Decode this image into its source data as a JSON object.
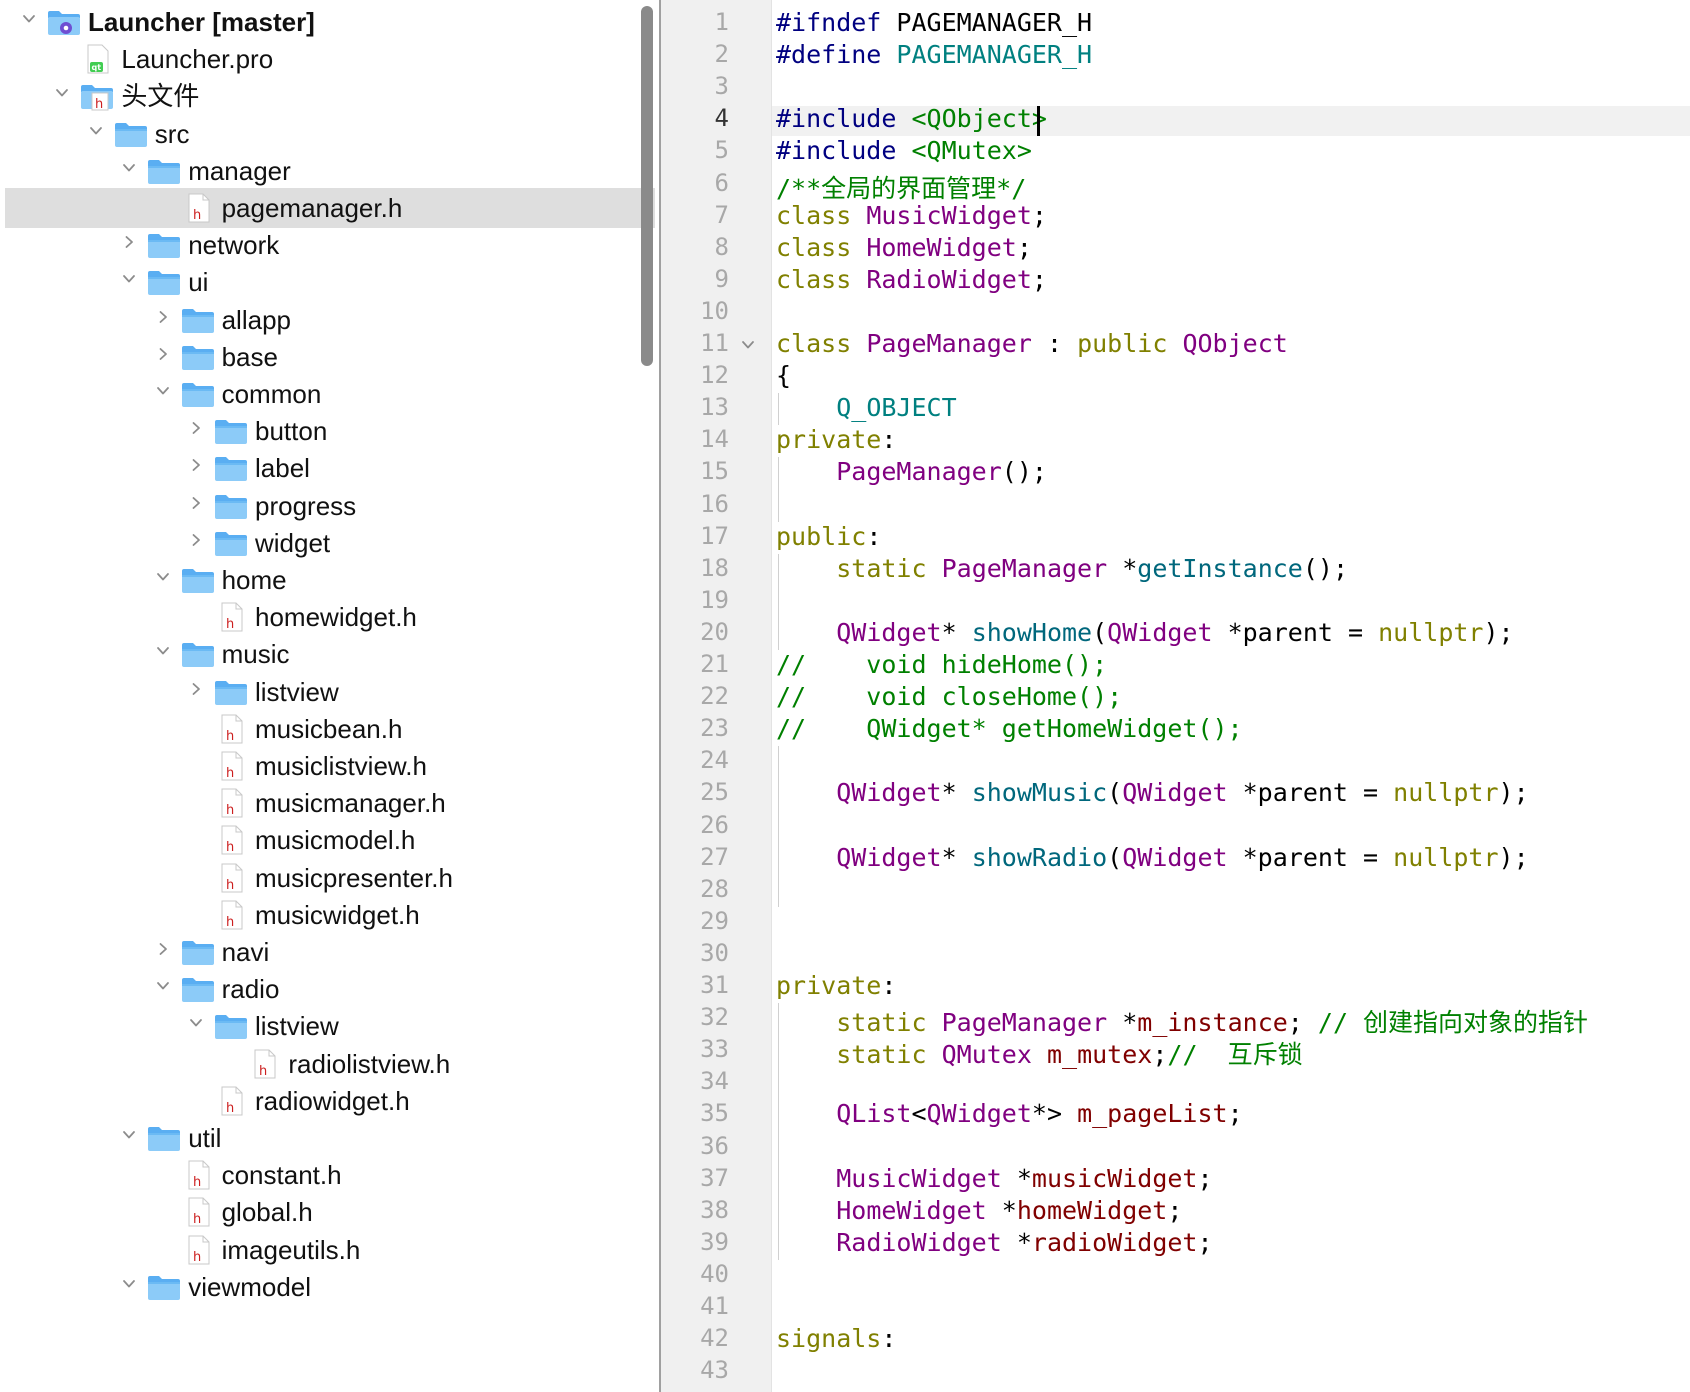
{
  "project_tree": {
    "items": [
      {
        "label": "Launcher [master]",
        "icon": "qt-project-icon",
        "expanded": true,
        "bold": true,
        "depth": 0
      },
      {
        "label": "Launcher.pro",
        "icon": "qt-pro-file-icon",
        "expanded": null,
        "depth": 1
      },
      {
        "label": "头文件",
        "icon": "header-group-icon",
        "expanded": true,
        "depth": 1
      },
      {
        "label": "src",
        "icon": "folder-icon",
        "expanded": true,
        "depth": 2
      },
      {
        "label": "manager",
        "icon": "folder-icon",
        "expanded": true,
        "depth": 3
      },
      {
        "label": "pagemanager.h",
        "icon": "header-file-icon",
        "expanded": null,
        "depth": 4,
        "selected": true
      },
      {
        "label": "network",
        "icon": "folder-icon",
        "expanded": false,
        "depth": 3
      },
      {
        "label": "ui",
        "icon": "folder-icon",
        "expanded": true,
        "depth": 3
      },
      {
        "label": "allapp",
        "icon": "folder-icon",
        "expanded": false,
        "depth": 4
      },
      {
        "label": "base",
        "icon": "folder-icon",
        "expanded": false,
        "depth": 4
      },
      {
        "label": "common",
        "icon": "folder-icon",
        "expanded": true,
        "depth": 4
      },
      {
        "label": "button",
        "icon": "folder-icon",
        "expanded": false,
        "depth": 5
      },
      {
        "label": "label",
        "icon": "folder-icon",
        "expanded": false,
        "depth": 5
      },
      {
        "label": "progress",
        "icon": "folder-icon",
        "expanded": false,
        "depth": 5
      },
      {
        "label": "widget",
        "icon": "folder-icon",
        "expanded": false,
        "depth": 5
      },
      {
        "label": "home",
        "icon": "folder-icon",
        "expanded": true,
        "depth": 4
      },
      {
        "label": "homewidget.h",
        "icon": "header-file-icon",
        "expanded": null,
        "depth": 5
      },
      {
        "label": "music",
        "icon": "folder-icon",
        "expanded": true,
        "depth": 4
      },
      {
        "label": "listview",
        "icon": "folder-icon",
        "expanded": false,
        "depth": 5
      },
      {
        "label": "musicbean.h",
        "icon": "header-file-icon",
        "expanded": null,
        "depth": 5
      },
      {
        "label": "musiclistview.h",
        "icon": "header-file-icon",
        "expanded": null,
        "depth": 5
      },
      {
        "label": "musicmanager.h",
        "icon": "header-file-icon",
        "expanded": null,
        "depth": 5
      },
      {
        "label": "musicmodel.h",
        "icon": "header-file-icon",
        "expanded": null,
        "depth": 5
      },
      {
        "label": "musicpresenter.h",
        "icon": "header-file-icon",
        "expanded": null,
        "depth": 5
      },
      {
        "label": "musicwidget.h",
        "icon": "header-file-icon",
        "expanded": null,
        "depth": 5
      },
      {
        "label": "navi",
        "icon": "folder-icon",
        "expanded": false,
        "depth": 4
      },
      {
        "label": "radio",
        "icon": "folder-icon",
        "expanded": true,
        "depth": 4
      },
      {
        "label": "listview",
        "icon": "folder-icon",
        "expanded": true,
        "depth": 5
      },
      {
        "label": "radiolistview.h",
        "icon": "header-file-icon",
        "expanded": null,
        "depth": 6
      },
      {
        "label": "radiowidget.h",
        "icon": "header-file-icon",
        "expanded": null,
        "depth": 5
      },
      {
        "label": "util",
        "icon": "folder-icon",
        "expanded": true,
        "depth": 3
      },
      {
        "label": "constant.h",
        "icon": "header-file-icon",
        "expanded": null,
        "depth": 4
      },
      {
        "label": "global.h",
        "icon": "header-file-icon",
        "expanded": null,
        "depth": 4
      },
      {
        "label": "imageutils.h",
        "icon": "header-file-icon",
        "expanded": null,
        "depth": 4
      },
      {
        "label": "viewmodel",
        "icon": "folder-icon",
        "expanded": true,
        "depth": 3
      }
    ]
  },
  "editor": {
    "current_line": 4,
    "fold_marker_line": 11,
    "lines": [
      {
        "n": "1",
        "tokens": [
          [
            "#ifndef",
            "pp"
          ],
          [
            " PAGEMANAGER_H",
            "p"
          ]
        ]
      },
      {
        "n": "2",
        "tokens": [
          [
            "#define",
            "pp"
          ],
          [
            " ",
            "p"
          ],
          [
            "PAGEMANAGER_H",
            "mac"
          ]
        ]
      },
      {
        "n": "3",
        "tokens": []
      },
      {
        "n": "4",
        "tokens": [
          [
            "#include",
            "pp"
          ],
          [
            " ",
            "p"
          ],
          [
            "<QObject>",
            "str"
          ]
        ]
      },
      {
        "n": "5",
        "tokens": [
          [
            "#include",
            "pp"
          ],
          [
            " ",
            "p"
          ],
          [
            "<QMutex>",
            "str"
          ]
        ]
      },
      {
        "n": "6",
        "tokens": [
          [
            "/**全局的界面管理*/",
            "cmt"
          ]
        ]
      },
      {
        "n": "7",
        "tokens": [
          [
            "class",
            "kw"
          ],
          [
            " ",
            "p"
          ],
          [
            "MusicWidget",
            "cls"
          ],
          [
            ";",
            "p"
          ]
        ]
      },
      {
        "n": "8",
        "tokens": [
          [
            "class",
            "kw"
          ],
          [
            " ",
            "p"
          ],
          [
            "HomeWidget",
            "cls"
          ],
          [
            ";",
            "p"
          ]
        ]
      },
      {
        "n": "9",
        "tokens": [
          [
            "class",
            "kw"
          ],
          [
            " ",
            "p"
          ],
          [
            "RadioWidget",
            "cls"
          ],
          [
            ";",
            "p"
          ]
        ]
      },
      {
        "n": "10",
        "tokens": []
      },
      {
        "n": "11",
        "tokens": [
          [
            "class",
            "kw"
          ],
          [
            " ",
            "p"
          ],
          [
            "PageManager",
            "cls"
          ],
          [
            " : ",
            "p"
          ],
          [
            "public",
            "kw"
          ],
          [
            " ",
            "p"
          ],
          [
            "QObject",
            "cls"
          ]
        ]
      },
      {
        "n": "12",
        "tokens": [
          [
            "{",
            "p"
          ]
        ]
      },
      {
        "n": "13",
        "tokens": [
          [
            "    ",
            "p"
          ],
          [
            "Q_OBJECT",
            "mac"
          ]
        ]
      },
      {
        "n": "14",
        "tokens": [
          [
            "private",
            "kw"
          ],
          [
            ":",
            "p"
          ]
        ]
      },
      {
        "n": "15",
        "tokens": [
          [
            "    ",
            "p"
          ],
          [
            "PageManager",
            "cls"
          ],
          [
            "();",
            "p"
          ]
        ]
      },
      {
        "n": "16",
        "tokens": []
      },
      {
        "n": "17",
        "tokens": [
          [
            "public",
            "kw"
          ],
          [
            ":",
            "p"
          ]
        ]
      },
      {
        "n": "18",
        "tokens": [
          [
            "    ",
            "p"
          ],
          [
            "static",
            "kw"
          ],
          [
            " ",
            "p"
          ],
          [
            "PageManager",
            "cls"
          ],
          [
            " *",
            "p"
          ],
          [
            "getInstance",
            "fnc"
          ],
          [
            "();",
            "p"
          ]
        ]
      },
      {
        "n": "19",
        "tokens": []
      },
      {
        "n": "20",
        "tokens": [
          [
            "    ",
            "p"
          ],
          [
            "QWidget",
            "cls"
          ],
          [
            "* ",
            "p"
          ],
          [
            "showHome",
            "fnc"
          ],
          [
            "(",
            "p"
          ],
          [
            "QWidget",
            "cls"
          ],
          [
            " *parent = ",
            "p"
          ],
          [
            "nullptr",
            "kw"
          ],
          [
            ");",
            "p"
          ]
        ]
      },
      {
        "n": "21",
        "tokens": [
          [
            "//    void hideHome();",
            "cmt"
          ]
        ]
      },
      {
        "n": "22",
        "tokens": [
          [
            "//    void closeHome();",
            "cmt"
          ]
        ]
      },
      {
        "n": "23",
        "tokens": [
          [
            "//    QWidget* getHomeWidget();",
            "cmt"
          ]
        ]
      },
      {
        "n": "24",
        "tokens": []
      },
      {
        "n": "25",
        "tokens": [
          [
            "    ",
            "p"
          ],
          [
            "QWidget",
            "cls"
          ],
          [
            "* ",
            "p"
          ],
          [
            "showMusic",
            "fnc"
          ],
          [
            "(",
            "p"
          ],
          [
            "QWidget",
            "cls"
          ],
          [
            " *parent = ",
            "p"
          ],
          [
            "nullptr",
            "kw"
          ],
          [
            ");",
            "p"
          ]
        ]
      },
      {
        "n": "26",
        "tokens": []
      },
      {
        "n": "27",
        "tokens": [
          [
            "    ",
            "p"
          ],
          [
            "QWidget",
            "cls"
          ],
          [
            "* ",
            "p"
          ],
          [
            "showRadio",
            "fnc"
          ],
          [
            "(",
            "p"
          ],
          [
            "QWidget",
            "cls"
          ],
          [
            " *parent = ",
            "p"
          ],
          [
            "nullptr",
            "kw"
          ],
          [
            ");",
            "p"
          ]
        ]
      },
      {
        "n": "28",
        "tokens": []
      },
      {
        "n": "29",
        "tokens": []
      },
      {
        "n": "30",
        "tokens": []
      },
      {
        "n": "31",
        "tokens": [
          [
            "private",
            "kw"
          ],
          [
            ":",
            "p"
          ]
        ]
      },
      {
        "n": "32",
        "tokens": [
          [
            "    ",
            "p"
          ],
          [
            "static",
            "kw"
          ],
          [
            " ",
            "p"
          ],
          [
            "PageManager",
            "cls"
          ],
          [
            " *",
            "p"
          ],
          [
            "m_instance",
            "mem"
          ],
          [
            "; ",
            "p"
          ],
          [
            "// 创建指向对象的指针",
            "cmt"
          ]
        ]
      },
      {
        "n": "33",
        "tokens": [
          [
            "    ",
            "p"
          ],
          [
            "static",
            "kw"
          ],
          [
            " ",
            "p"
          ],
          [
            "QMutex",
            "cls"
          ],
          [
            " ",
            "p"
          ],
          [
            "m_mutex",
            "mem"
          ],
          [
            ";",
            "p"
          ],
          [
            "//  互斥锁",
            "cmt"
          ]
        ]
      },
      {
        "n": "34",
        "tokens": []
      },
      {
        "n": "35",
        "tokens": [
          [
            "    ",
            "p"
          ],
          [
            "QList",
            "cls"
          ],
          [
            "<",
            "p"
          ],
          [
            "QWidget",
            "cls"
          ],
          [
            "*> ",
            "p"
          ],
          [
            "m_pageList",
            "mem"
          ],
          [
            ";",
            "p"
          ]
        ]
      },
      {
        "n": "36",
        "tokens": []
      },
      {
        "n": "37",
        "tokens": [
          [
            "    ",
            "p"
          ],
          [
            "MusicWidget",
            "cls"
          ],
          [
            " *",
            "p"
          ],
          [
            "musicWidget",
            "mem"
          ],
          [
            ";",
            "p"
          ]
        ]
      },
      {
        "n": "38",
        "tokens": [
          [
            "    ",
            "p"
          ],
          [
            "HomeWidget",
            "cls"
          ],
          [
            " *",
            "p"
          ],
          [
            "homeWidget",
            "mem"
          ],
          [
            ";",
            "p"
          ]
        ]
      },
      {
        "n": "39",
        "tokens": [
          [
            "    ",
            "p"
          ],
          [
            "RadioWidget",
            "cls"
          ],
          [
            " *",
            "p"
          ],
          [
            "radioWidget",
            "mem"
          ],
          [
            ";",
            "p"
          ]
        ]
      },
      {
        "n": "40",
        "tokens": []
      },
      {
        "n": "41",
        "tokens": []
      },
      {
        "n": "42",
        "tokens": [
          [
            "signals",
            "kw"
          ],
          [
            ":",
            "p"
          ]
        ]
      },
      {
        "n": "43",
        "tokens": []
      }
    ]
  }
}
